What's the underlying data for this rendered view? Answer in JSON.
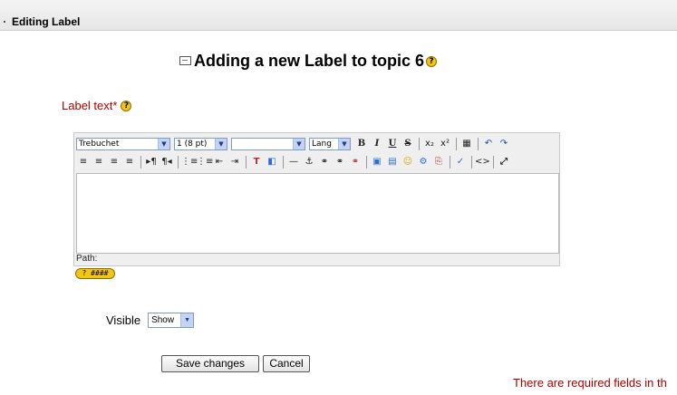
{
  "header": {
    "title": "Editing Label"
  },
  "page": {
    "heading": "Adding a new Label to topic 6"
  },
  "form": {
    "label_text": "Label text*",
    "editor": {
      "font_family": "Trebuchet",
      "font_size": "1 (8 pt)",
      "format": "",
      "language": "Lang",
      "path_label": "Path:",
      "row1_buttons": [
        "B",
        "I",
        "U",
        "S",
        "x₂",
        "x²",
        "▦",
        "↶",
        "↷"
      ],
      "row2_buttons": [
        "≡",
        "≡",
        "≡",
        "≡",
        "▸¶",
        "¶◂",
        "⋮≡",
        "⋮≡",
        "⇤",
        "⇥",
        "T",
        "◧",
        "—",
        "⚓",
        "⚭",
        "⚭",
        "⚭",
        "▣",
        "▤",
        "☺",
        "⚙",
        "⎘",
        "✓",
        "<>",
        "⤢"
      ]
    },
    "keyboard_help": "? ####",
    "visible_label": "Visible",
    "visible_value": "Show",
    "save_label": "Save changes",
    "cancel_label": "Cancel",
    "required_note": "There are required fields in th"
  }
}
